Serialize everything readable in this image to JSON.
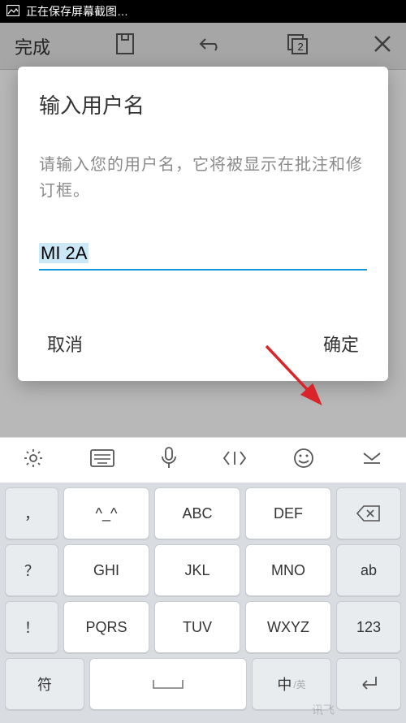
{
  "status_bar": {
    "text": "正在保存屏幕截图…"
  },
  "toolbar": {
    "done": "完成",
    "tab_count": "2"
  },
  "dialog": {
    "title": "输入用户名",
    "description": "请输入您的用户名，它将被显示在批注和修订框。",
    "input_value": "MI 2A",
    "cancel": "取消",
    "confirm": "确定"
  },
  "keyboard": {
    "row1": {
      "punct": "，",
      "k1": "^_^",
      "k2": "ABC",
      "k3": "DEF",
      "side": "⌫"
    },
    "row2": {
      "punct": "？",
      "k1": "GHI",
      "k2": "JKL",
      "k3": "MNO",
      "side": "ab"
    },
    "row3": {
      "punct": "！",
      "k1": "PQRS",
      "k2": "TUV",
      "k3": "WXYZ",
      "side": "123"
    },
    "row4": {
      "k1": "符",
      "k2": "",
      "k3": "中",
      "k3_sub": "/英",
      "side": "↵"
    }
  },
  "watermark": "讯飞"
}
